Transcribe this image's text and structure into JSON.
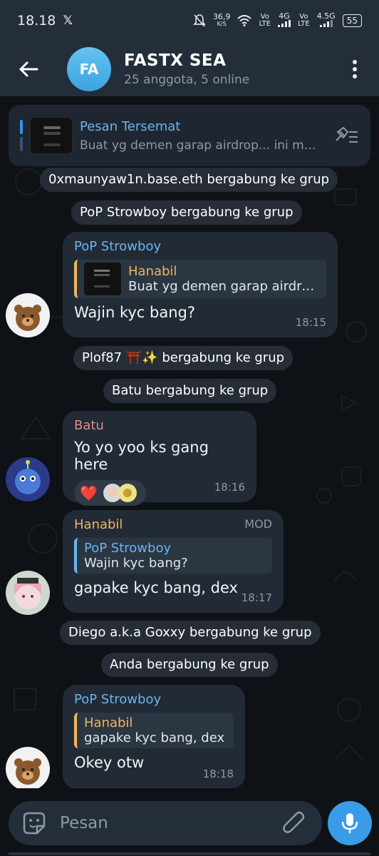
{
  "status_bar": {
    "time": "18.18",
    "app_icon": "x-logo",
    "speed_value": "36,9",
    "speed_unit": "K/S",
    "vo1": "Vo",
    "lte1": "LTE",
    "net1": "4G",
    "vo2": "Vo",
    "lte2": "LTE",
    "net2": "4.5G",
    "battery": "55"
  },
  "header": {
    "avatar_initials": "FA",
    "title": "FASTX SEA",
    "subtitle": "25 anggota, 5 online"
  },
  "pinned": {
    "label": "Pesan Tersemat",
    "message": "Buat yg demen garap airdrop... ini mu..."
  },
  "messages": {
    "svc1": "0xmaunyaw1n.base.eth bergabung ke grup",
    "svc2": "PoP Strowboy bergabung ke grup",
    "m1": {
      "sender": "PoP Strowboy",
      "reply_name": "Hanabil",
      "reply_text": "Buat yg demen garap airdrop...",
      "text": "Wajin kyc bang?",
      "time": "18:15"
    },
    "svc3": "Plof87 ⛩️✨ bergabung ke grup",
    "svc4": "Batu bergabung ke grup",
    "m2": {
      "sender": "Batu",
      "text": "Yo yo yoo ks gang here",
      "reaction": "❤️",
      "time": "18:16"
    },
    "m3": {
      "sender": "Hanabil",
      "badge": "MOD",
      "reply_name": "PoP Strowboy",
      "reply_text": "Wajin kyc bang?",
      "text": "gapake kyc bang, dex",
      "time": "18:17"
    },
    "svc5": "Diego a.k.a Goxxy bergabung ke grup",
    "svc6": "Anda bergabung ke grup",
    "m4": {
      "sender": "PoP Strowboy",
      "reply_name": "Hanabil",
      "reply_text": "gapake kyc bang, dex",
      "text": "Okey otw",
      "time": "18:18"
    }
  },
  "input": {
    "placeholder": "Pesan"
  },
  "colors": {
    "accent": "#3a9be7",
    "sender_blue": "#6cb4f0",
    "sender_red": "#e8888a",
    "sender_orange": "#f0b562"
  }
}
